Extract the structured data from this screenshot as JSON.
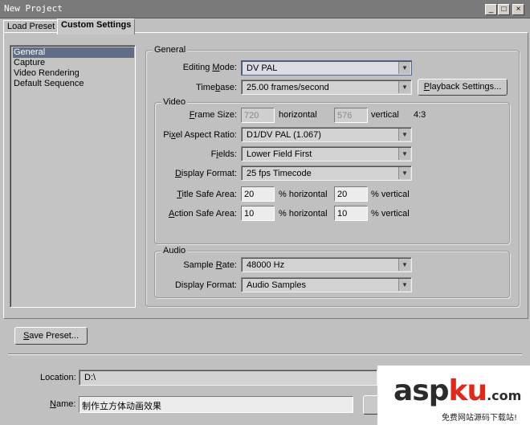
{
  "window": {
    "title": "New Project",
    "minimize": "_",
    "maximize": "□",
    "close": "×"
  },
  "tabs": [
    {
      "label": "Load Preset"
    },
    {
      "label": "Custom Settings"
    }
  ],
  "sidebar": {
    "items": [
      {
        "label": "General"
      },
      {
        "label": "Capture"
      },
      {
        "label": "Video Rendering"
      },
      {
        "label": "Default Sequence"
      }
    ]
  },
  "general": {
    "group_label": "General",
    "editing_mode": {
      "label_u": "M",
      "label_pre": "Editing ",
      "label_post": "ode:",
      "value": "DV PAL"
    },
    "timebase": {
      "label_pre": "Time",
      "label_u": "b",
      "label_post": "ase:",
      "value": "25.00 frames/second"
    },
    "playback_button": {
      "label_u": "P",
      "label_post": "layback Settings..."
    }
  },
  "video": {
    "group_label": "Video",
    "frame_size": {
      "label_u": "F",
      "label_post": "rame Size:",
      "width": "720",
      "horizontal": "horizontal",
      "height": "576",
      "vertical": "vertical",
      "ratio": "4:3"
    },
    "pixel_aspect": {
      "label_pre": "Pi",
      "label_u": "x",
      "label_post": "el Aspect Ratio:",
      "value": "D1/DV PAL (1.067)"
    },
    "fields": {
      "label_pre": "F",
      "label_u": "i",
      "label_post": "elds:",
      "value": "Lower Field First"
    },
    "display_format": {
      "label_u": "D",
      "label_post": "isplay Format:",
      "value": "25 fps Timecode"
    },
    "title_safe": {
      "label_u": "T",
      "label_post": "itle Safe Area:",
      "h": "20",
      "h_label": "% horizontal",
      "v": "20",
      "v_label": "% vertical"
    },
    "action_safe": {
      "label_u": "A",
      "label_post": "ction Safe Area:",
      "h": "10",
      "h_label": "% horizontal",
      "v": "10",
      "v_label": "% vertical"
    }
  },
  "audio": {
    "group_label": "Audio",
    "sample_rate": {
      "label_pre": "Sample ",
      "label_u": "R",
      "label_post": "ate:",
      "value": "48000 Hz"
    },
    "display_format": {
      "label": "Display Format:",
      "value": "Audio Samples"
    }
  },
  "save_preset": {
    "label_u": "S",
    "label_post": "ave Preset..."
  },
  "location": {
    "label": "Location:",
    "value": "D:\\"
  },
  "name": {
    "label_u": "N",
    "label_post": "ame:",
    "value": "制作立方体动画效果"
  },
  "logo": {
    "brand_a": "asp",
    "brand_b": "ku",
    "tld": ".com",
    "tagline": "免费网站源码下载站!"
  },
  "colors": {
    "accent": "#5f6e86",
    "logo_red": "#e0281b",
    "logo_dark": "#2b2b2b"
  }
}
